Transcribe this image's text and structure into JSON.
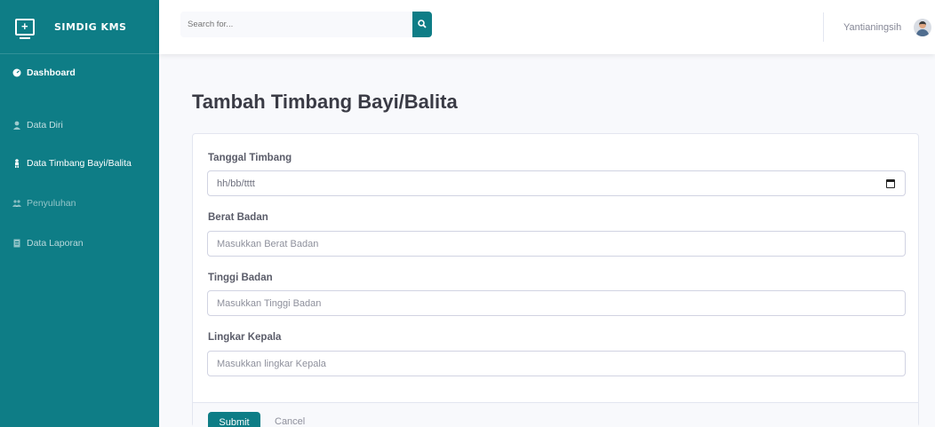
{
  "brand": {
    "name": "SIMDIG KMS"
  },
  "sidebar": {
    "items": [
      {
        "label": "Dashboard",
        "icon": "dashboard-icon"
      },
      {
        "label": "Data Diri",
        "icon": "user-icon"
      },
      {
        "label": "Data Timbang Bayi/Balita",
        "icon": "baby-icon"
      },
      {
        "label": "Penyuluhan",
        "icon": "users-icon"
      },
      {
        "label": "Data Laporan",
        "icon": "report-icon"
      }
    ]
  },
  "topbar": {
    "search_placeholder": "Search for...",
    "username": "Yantianingsih"
  },
  "page": {
    "title": "Tambah Timbang Bayi/Balita"
  },
  "form": {
    "tanggal_label": "Tanggal Timbang",
    "tanggal_value": "hh/bb/tttt",
    "berat_label": "Berat Badan",
    "berat_placeholder": "Masukkan Berat Badan",
    "tinggi_label": "Tinggi Badan",
    "tinggi_placeholder": "Masukkan Tinggi Badan",
    "lingkar_label": "Lingkar Kepala",
    "lingkar_placeholder": "Masukkan lingkar Kepala",
    "submit_label": "Submit",
    "cancel_label": "Cancel"
  },
  "colors": {
    "accent": "#0e7d86",
    "background": "#f8f9fc"
  }
}
